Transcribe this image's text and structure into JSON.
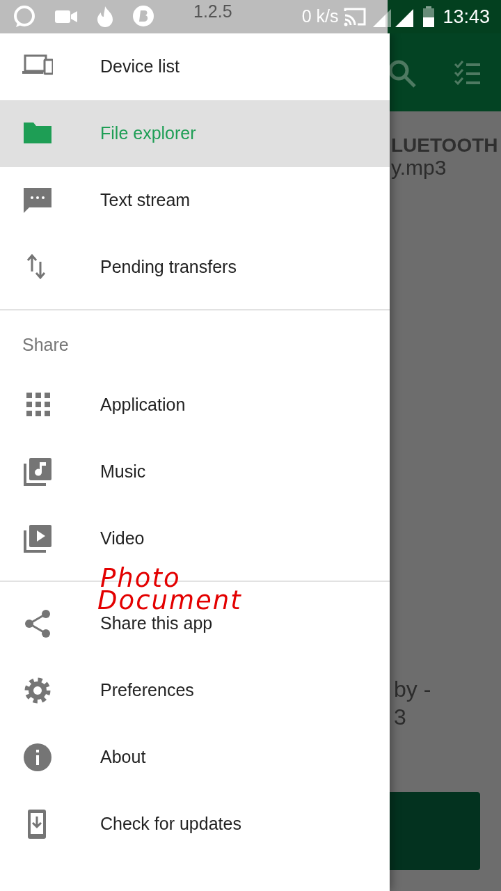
{
  "status_bar": {
    "app_version": "1.2.5",
    "speed": "0 k/s",
    "time": "13:43"
  },
  "background": {
    "tab_label": "LUETOOTH",
    "file_name": "y.mp3",
    "texts": [
      "by -",
      "3"
    ]
  },
  "drawer": {
    "sections": [
      {
        "items": [
          {
            "kind": "devices",
            "label": "Device list",
            "selected": false
          },
          {
            "kind": "folder",
            "label": "File explorer",
            "selected": true
          },
          {
            "kind": "message",
            "label": "Text stream",
            "selected": false
          },
          {
            "kind": "transfer",
            "label": "Pending transfers",
            "selected": false
          }
        ]
      },
      {
        "header": "Share",
        "items": [
          {
            "kind": "apps",
            "label": "Application",
            "selected": false
          },
          {
            "kind": "music",
            "label": "Music",
            "selected": false
          },
          {
            "kind": "video",
            "label": "Video",
            "selected": false
          }
        ]
      },
      {
        "items": [
          {
            "kind": "share",
            "label": "Share this app",
            "selected": false
          },
          {
            "kind": "settings",
            "label": "Preferences",
            "selected": false
          },
          {
            "kind": "info",
            "label": "About",
            "selected": false
          },
          {
            "kind": "update",
            "label": "Check for updates",
            "selected": false
          }
        ]
      }
    ]
  },
  "annotation": {
    "lines": [
      "Photo",
      "Document"
    ]
  }
}
